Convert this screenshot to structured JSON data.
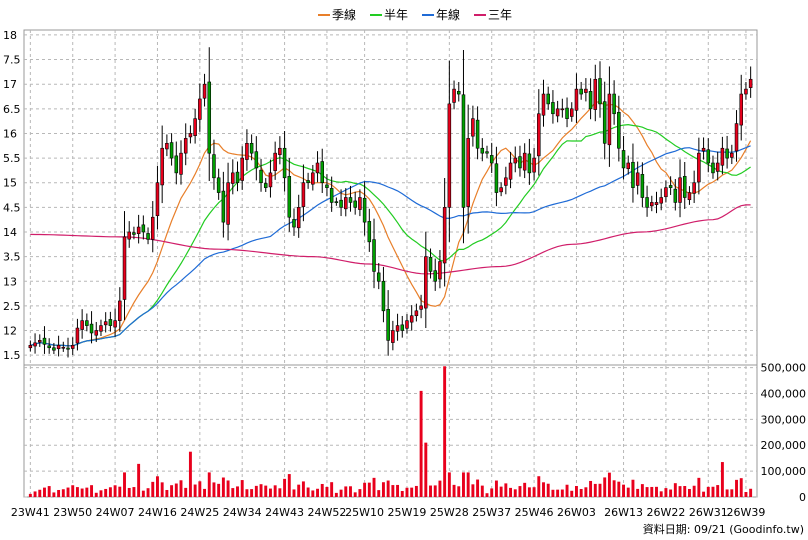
{
  "chart_data": {
    "type": "candlestick",
    "interval": "weekly",
    "legend": {
      "placement": "top-center",
      "items": [
        {
          "key": "ma_quarter",
          "label": "季線",
          "color": "#e87f2a"
        },
        {
          "key": "ma_half",
          "label": "半年",
          "color": "#22cc22"
        },
        {
          "key": "ma_year",
          "label": "年線",
          "color": "#1f6bd6"
        },
        {
          "key": "ma_3y",
          "label": "三年",
          "color": "#d01e6a"
        }
      ]
    },
    "price_axis": {
      "ticks": [
        11.5,
        12,
        12.5,
        13,
        13.5,
        14,
        14.5,
        15,
        15.5,
        16,
        16.5,
        17,
        17.5,
        18
      ],
      "tick_labels": [
        "1.5",
        "12",
        "2.5",
        "13",
        "3.5",
        "14",
        "4.5",
        "15",
        "5.5",
        "16",
        "6.5",
        "17",
        "7.5",
        "18"
      ],
      "range": [
        11.3,
        18.1
      ],
      "grid": true
    },
    "volume_axis": {
      "ticks": [
        0,
        100000,
        200000,
        300000,
        400000,
        500000
      ],
      "tick_labels": [
        "0",
        "100,000",
        "200,000",
        "300,000",
        "400,000",
        "500,000"
      ],
      "range": [
        0,
        510000
      ]
    },
    "x_labels": [
      {
        "label": "23W41",
        "index": 0
      },
      {
        "label": "23W50",
        "index": 9
      },
      {
        "label": "24W07",
        "index": 18
      },
      {
        "label": "24W16",
        "index": 27
      },
      {
        "label": "24W25",
        "index": 36
      },
      {
        "label": "24W34",
        "index": 45
      },
      {
        "label": "24W43",
        "index": 54
      },
      {
        "label": "24W52",
        "index": 63
      },
      {
        "label": "25W10",
        "index": 71
      },
      {
        "label": "25W19",
        "index": 80
      },
      {
        "label": "25W28",
        "index": 89
      },
      {
        "label": "25W37",
        "index": 98
      },
      {
        "label": "25W46",
        "index": 107
      },
      {
        "label": "26W03",
        "index": 116
      },
      {
        "label": "26W13",
        "index": 126
      },
      {
        "label": "26W22",
        "index": 135
      },
      {
        "label": "26W31",
        "index": 144
      },
      {
        "label": "26W39",
        "index": 152
      }
    ],
    "closes": [
      11.7,
      11.75,
      11.8,
      11.72,
      11.65,
      11.6,
      11.7,
      11.66,
      11.62,
      11.7,
      12.05,
      12.2,
      12.1,
      11.95,
      12.0,
      12.1,
      12.18,
      12.1,
      12.2,
      12.6,
      13.9,
      14.0,
      13.95,
      14.1,
      14.0,
      13.85,
      14.3,
      15.0,
      15.7,
      15.8,
      15.5,
      15.2,
      15.6,
      15.9,
      16.0,
      16.3,
      16.7,
      17.0,
      15.6,
      15.1,
      14.8,
      14.2,
      15.0,
      15.2,
      15.0,
      15.5,
      15.8,
      15.6,
      15.3,
      15.0,
      14.9,
      15.2,
      15.6,
      15.7,
      15.1,
      14.3,
      14.1,
      14.5,
      15.0,
      15.0,
      15.2,
      15.4,
      15.0,
      14.9,
      14.6,
      14.6,
      14.5,
      14.7,
      14.6,
      14.5,
      14.7,
      14.2,
      13.8,
      13.2,
      13.0,
      12.4,
      11.8,
      12.0,
      12.1,
      12.0,
      12.2,
      12.3,
      12.4,
      12.5,
      13.5,
      13.2,
      13.0,
      13.4,
      14.5,
      16.6,
      16.9,
      16.8,
      14.5,
      15.9,
      16.3,
      15.7,
      15.6,
      15.6,
      15.4,
      14.8,
      14.9,
      15.1,
      15.4,
      15.5,
      15.3,
      15.6,
      15.2,
      15.5,
      16.4,
      16.8,
      16.6,
      16.4,
      16.5,
      16.5,
      16.3,
      16.5,
      16.9,
      16.8,
      16.9,
      16.5,
      17.1,
      16.6,
      15.8,
      16.8,
      16.4,
      15.7,
      15.3,
      15.4,
      14.9,
      15.2,
      14.7,
      14.5,
      14.6,
      14.6,
      14.7,
      14.9,
      14.9,
      14.6,
      15.1,
      14.7,
      14.8,
      15.0,
      15.6,
      15.7,
      15.4,
      15.2,
      15.4,
      15.7,
      15.5,
      15.6,
      16.2,
      16.8,
      16.9,
      17.1
    ],
    "volume_peaks": [
      {
        "index": 23,
        "value": 128000
      },
      {
        "index": 34,
        "value": 175000
      },
      {
        "index": 83,
        "value": 410000
      },
      {
        "index": 84,
        "value": 210000
      },
      {
        "index": 88,
        "value": 505000
      },
      {
        "index": 147,
        "value": 135000
      }
    ],
    "footer_label": "資料日期: 09/21  (Goodinfo.tw)"
  }
}
